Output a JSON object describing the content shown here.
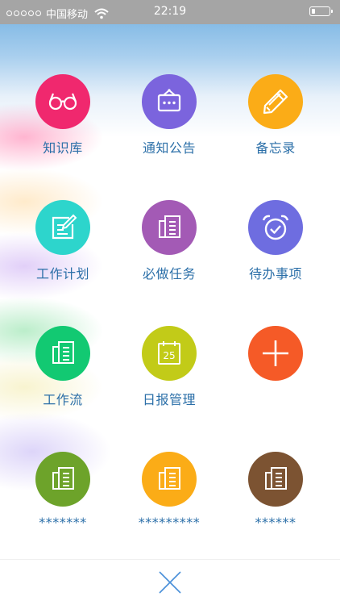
{
  "status_bar": {
    "carrier": "中国移动",
    "time": "22:19",
    "signal_icon": "signal-dots-icon",
    "wifi_icon": "wifi-icon",
    "battery_icon": "battery-icon",
    "battery_level": 0.2
  },
  "tiles": [
    {
      "label": "知识库",
      "color": "#f0286e",
      "icon": "glasses-icon"
    },
    {
      "label": "通知公告",
      "color": "#7b64dd",
      "icon": "notice-board-icon"
    },
    {
      "label": "备忘录",
      "color": "#fbac17",
      "icon": "pencil-icon"
    },
    {
      "label": "工作计划",
      "color": "#2dd5cc",
      "icon": "edit-note-icon"
    },
    {
      "label": "必做任务",
      "color": "#a35ab5",
      "icon": "document-icon"
    },
    {
      "label": "待办事项",
      "color": "#6e6de0",
      "icon": "alarm-clock-icon"
    },
    {
      "label": "工作流",
      "color": "#12c972",
      "icon": "document-icon"
    },
    {
      "label": "日报管理",
      "color": "#c2cb18",
      "icon": "calendar-icon",
      "calendar_day": "25"
    },
    {
      "label": "",
      "color": "#f55a27",
      "icon": "plus-icon"
    },
    {
      "label": "*******",
      "color": "#6da32a",
      "icon": "document-icon"
    },
    {
      "label": "*********",
      "color": "#fbac17",
      "icon": "document-icon"
    },
    {
      "label": "******",
      "color": "#7c5332",
      "icon": "document-icon"
    }
  ],
  "bottom_bar": {
    "close_icon": "close-icon"
  }
}
